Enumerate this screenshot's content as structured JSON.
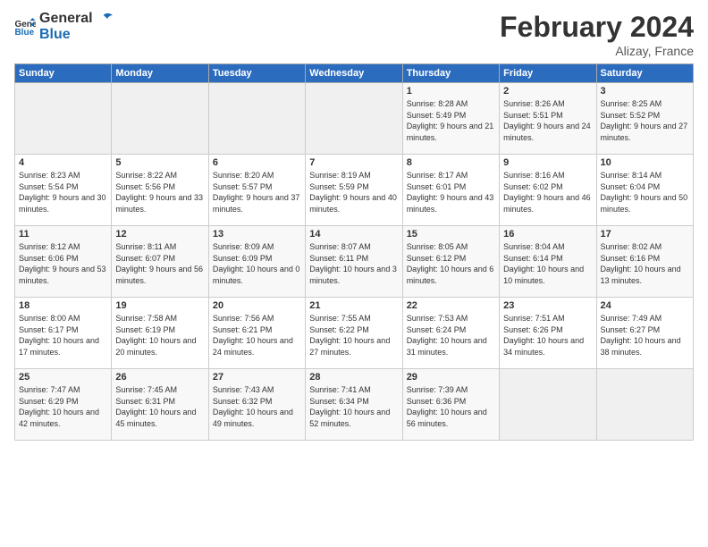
{
  "header": {
    "logo_line1": "General",
    "logo_line2": "Blue",
    "title": "February 2024",
    "subtitle": "Alizay, France"
  },
  "weekdays": [
    "Sunday",
    "Monday",
    "Tuesday",
    "Wednesday",
    "Thursday",
    "Friday",
    "Saturday"
  ],
  "weeks": [
    [
      {
        "day": "",
        "empty": true
      },
      {
        "day": "",
        "empty": true
      },
      {
        "day": "",
        "empty": true
      },
      {
        "day": "",
        "empty": true
      },
      {
        "day": "1",
        "sunrise": "8:28 AM",
        "sunset": "5:49 PM",
        "daylight": "9 hours and 21 minutes."
      },
      {
        "day": "2",
        "sunrise": "8:26 AM",
        "sunset": "5:51 PM",
        "daylight": "9 hours and 24 minutes."
      },
      {
        "day": "3",
        "sunrise": "8:25 AM",
        "sunset": "5:52 PM",
        "daylight": "9 hours and 27 minutes."
      }
    ],
    [
      {
        "day": "4",
        "sunrise": "8:23 AM",
        "sunset": "5:54 PM",
        "daylight": "9 hours and 30 minutes."
      },
      {
        "day": "5",
        "sunrise": "8:22 AM",
        "sunset": "5:56 PM",
        "daylight": "9 hours and 33 minutes."
      },
      {
        "day": "6",
        "sunrise": "8:20 AM",
        "sunset": "5:57 PM",
        "daylight": "9 hours and 37 minutes."
      },
      {
        "day": "7",
        "sunrise": "8:19 AM",
        "sunset": "5:59 PM",
        "daylight": "9 hours and 40 minutes."
      },
      {
        "day": "8",
        "sunrise": "8:17 AM",
        "sunset": "6:01 PM",
        "daylight": "9 hours and 43 minutes."
      },
      {
        "day": "9",
        "sunrise": "8:16 AM",
        "sunset": "6:02 PM",
        "daylight": "9 hours and 46 minutes."
      },
      {
        "day": "10",
        "sunrise": "8:14 AM",
        "sunset": "6:04 PM",
        "daylight": "9 hours and 50 minutes."
      }
    ],
    [
      {
        "day": "11",
        "sunrise": "8:12 AM",
        "sunset": "6:06 PM",
        "daylight": "9 hours and 53 minutes."
      },
      {
        "day": "12",
        "sunrise": "8:11 AM",
        "sunset": "6:07 PM",
        "daylight": "9 hours and 56 minutes."
      },
      {
        "day": "13",
        "sunrise": "8:09 AM",
        "sunset": "6:09 PM",
        "daylight": "10 hours and 0 minutes."
      },
      {
        "day": "14",
        "sunrise": "8:07 AM",
        "sunset": "6:11 PM",
        "daylight": "10 hours and 3 minutes."
      },
      {
        "day": "15",
        "sunrise": "8:05 AM",
        "sunset": "6:12 PM",
        "daylight": "10 hours and 6 minutes."
      },
      {
        "day": "16",
        "sunrise": "8:04 AM",
        "sunset": "6:14 PM",
        "daylight": "10 hours and 10 minutes."
      },
      {
        "day": "17",
        "sunrise": "8:02 AM",
        "sunset": "6:16 PM",
        "daylight": "10 hours and 13 minutes."
      }
    ],
    [
      {
        "day": "18",
        "sunrise": "8:00 AM",
        "sunset": "6:17 PM",
        "daylight": "10 hours and 17 minutes."
      },
      {
        "day": "19",
        "sunrise": "7:58 AM",
        "sunset": "6:19 PM",
        "daylight": "10 hours and 20 minutes."
      },
      {
        "day": "20",
        "sunrise": "7:56 AM",
        "sunset": "6:21 PM",
        "daylight": "10 hours and 24 minutes."
      },
      {
        "day": "21",
        "sunrise": "7:55 AM",
        "sunset": "6:22 PM",
        "daylight": "10 hours and 27 minutes."
      },
      {
        "day": "22",
        "sunrise": "7:53 AM",
        "sunset": "6:24 PM",
        "daylight": "10 hours and 31 minutes."
      },
      {
        "day": "23",
        "sunrise": "7:51 AM",
        "sunset": "6:26 PM",
        "daylight": "10 hours and 34 minutes."
      },
      {
        "day": "24",
        "sunrise": "7:49 AM",
        "sunset": "6:27 PM",
        "daylight": "10 hours and 38 minutes."
      }
    ],
    [
      {
        "day": "25",
        "sunrise": "7:47 AM",
        "sunset": "6:29 PM",
        "daylight": "10 hours and 42 minutes."
      },
      {
        "day": "26",
        "sunrise": "7:45 AM",
        "sunset": "6:31 PM",
        "daylight": "10 hours and 45 minutes."
      },
      {
        "day": "27",
        "sunrise": "7:43 AM",
        "sunset": "6:32 PM",
        "daylight": "10 hours and 49 minutes."
      },
      {
        "day": "28",
        "sunrise": "7:41 AM",
        "sunset": "6:34 PM",
        "daylight": "10 hours and 52 minutes."
      },
      {
        "day": "29",
        "sunrise": "7:39 AM",
        "sunset": "6:36 PM",
        "daylight": "10 hours and 56 minutes."
      },
      {
        "day": "",
        "empty": true
      },
      {
        "day": "",
        "empty": true
      }
    ]
  ]
}
